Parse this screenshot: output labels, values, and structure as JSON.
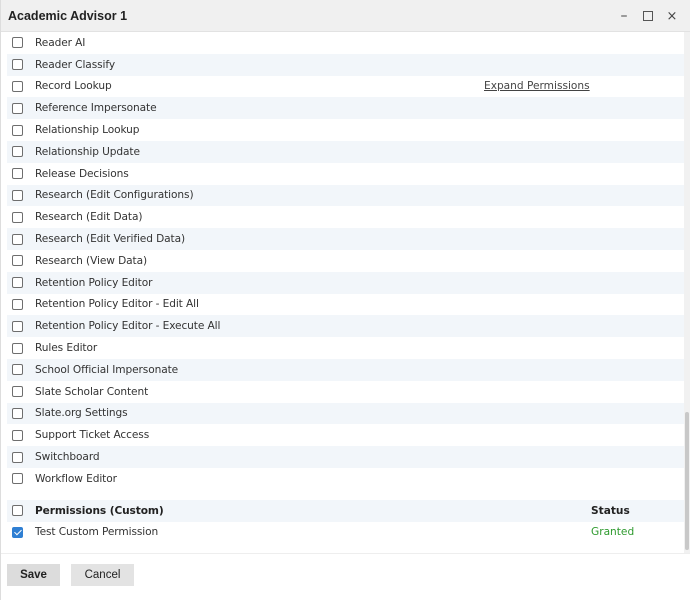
{
  "window": {
    "title": "Academic Advisor 1",
    "minimize_symbol": "–",
    "close_symbol": "×"
  },
  "permissions": [
    {
      "label": "Reader AI",
      "checked": false
    },
    {
      "label": "Reader Classify",
      "checked": false
    },
    {
      "label": "Record Lookup",
      "checked": false,
      "link": "Expand Permissions"
    },
    {
      "label": "Reference Impersonate",
      "checked": false
    },
    {
      "label": "Relationship Lookup",
      "checked": false
    },
    {
      "label": "Relationship Update",
      "checked": false
    },
    {
      "label": "Release Decisions",
      "checked": false
    },
    {
      "label": "Research (Edit Configurations)",
      "checked": false
    },
    {
      "label": "Research (Edit Data)",
      "checked": false
    },
    {
      "label": "Research (Edit Verified Data)",
      "checked": false
    },
    {
      "label": "Research (View Data)",
      "checked": false
    },
    {
      "label": "Retention Policy Editor",
      "checked": false
    },
    {
      "label": "Retention Policy Editor - Edit All",
      "checked": false
    },
    {
      "label": "Retention Policy Editor - Execute All",
      "checked": false
    },
    {
      "label": "Rules Editor",
      "checked": false
    },
    {
      "label": "School Official Impersonate",
      "checked": false
    },
    {
      "label": "Slate Scholar Content",
      "checked": false
    },
    {
      "label": "Slate.org Settings",
      "checked": false
    },
    {
      "label": "Support Ticket Access",
      "checked": false
    },
    {
      "label": "Switchboard",
      "checked": false
    },
    {
      "label": "Workflow Editor",
      "checked": false
    }
  ],
  "custom_section": {
    "header": "Permissions (Custom)",
    "status_header": "Status",
    "header_checked": false,
    "items": [
      {
        "label": "Test Custom Permission",
        "checked": true,
        "status": "Granted"
      }
    ]
  },
  "footer": {
    "save_label": "Save",
    "cancel_label": "Cancel"
  },
  "colors": {
    "accent": "#2f7fd3",
    "granted": "#2e9a2e",
    "row_alt": "#f2f6fa"
  }
}
